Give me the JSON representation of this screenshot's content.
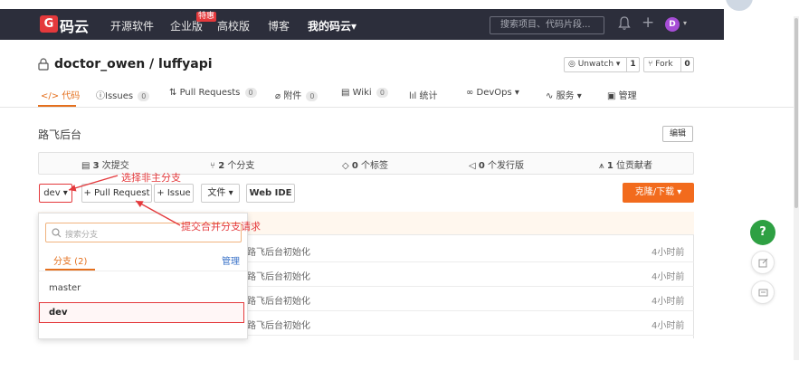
{
  "nav": {
    "logo": "码云",
    "links": [
      "开源软件",
      "企业版",
      "高校版",
      "博客",
      "我的码云"
    ],
    "special_badge": "特惠",
    "my_caret": "▾",
    "search_placeholder": "搜索项目、代码片段...",
    "avatar_letter": "D"
  },
  "repo": {
    "title": "doctor_owen / luffyapi",
    "watch_label": "Unwatch ▾",
    "watch_count": "1",
    "fork_label": "Fork",
    "fork_count": "0",
    "description": "路飞后台",
    "edit_label": "编辑"
  },
  "tabs": [
    {
      "label": "代码",
      "count": ""
    },
    {
      "label": "Issues",
      "count": "0"
    },
    {
      "label": "Pull Requests",
      "count": "0"
    },
    {
      "label": "附件",
      "count": "0"
    },
    {
      "label": "Wiki",
      "count": "0"
    },
    {
      "label": "统计",
      "count": ""
    },
    {
      "label": "DevOps ▾",
      "count": ""
    },
    {
      "label": "服务 ▾",
      "count": ""
    },
    {
      "label": "管理",
      "count": ""
    }
  ],
  "stats": {
    "commits_num": "3",
    "commits_label": "次提交",
    "branches_num": "2",
    "branches_label": "个分支",
    "tags_num": "0",
    "tags_label": "个标签",
    "releases_num": "0",
    "releases_label": "个发行版",
    "contributors_num": "1",
    "contributors_label": "位贡献者"
  },
  "toolbar": {
    "branch": "dev ▾",
    "pull_request": "+ Pull Request",
    "issue": "+ Issue",
    "file": "文件 ▾",
    "web_ide": "Web IDE",
    "clone": "克隆/下载 ▾"
  },
  "files": [
    {
      "commit": "路飞后台初始化",
      "time": "4小时前"
    },
    {
      "commit": "路飞后台初始化",
      "time": "4小时前"
    },
    {
      "commit": "路飞后台初始化",
      "time": "4小时前"
    },
    {
      "commit": "路飞后台初始化",
      "time": "4小时前"
    }
  ],
  "branch_dropdown": {
    "search_placeholder": "搜索分支",
    "tab_label": "分支 (2)",
    "manage": "管理",
    "branches": [
      "master",
      "dev"
    ]
  },
  "annotations": {
    "select_branch": "选择非主分支",
    "submit_merge": "提交合并分支请求"
  },
  "help": "?",
  "colors": {
    "brand": "#e4393c",
    "accent": "#e4701e",
    "clone": "#f26b1d",
    "help": "#2ea043",
    "nav_bg": "#2c2e3b"
  }
}
